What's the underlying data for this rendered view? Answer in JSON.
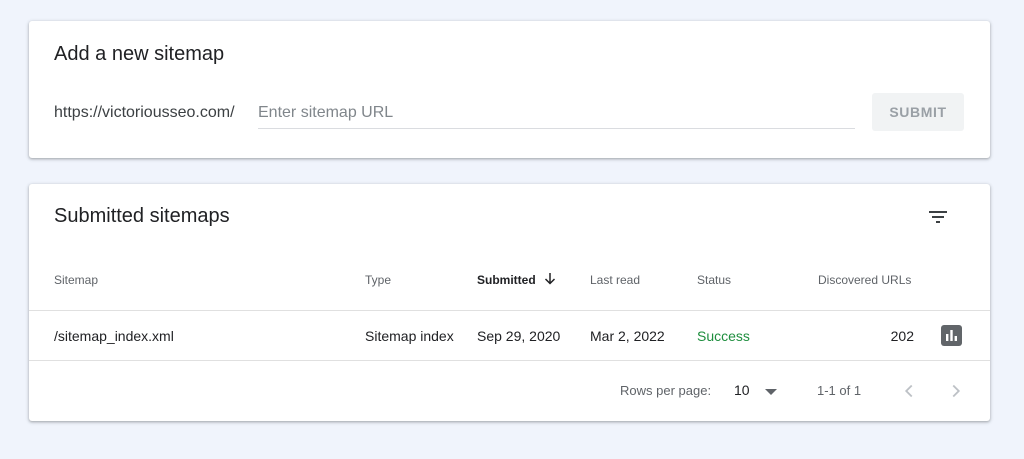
{
  "add_sitemap": {
    "title": "Add a new sitemap",
    "url_prefix": "https://victoriousseo.com/",
    "input_value": "",
    "input_placeholder": "Enter sitemap URL",
    "submit_label": "SUBMIT"
  },
  "submitted": {
    "title": "Submitted sitemaps",
    "columns": {
      "sitemap": "Sitemap",
      "type": "Type",
      "submitted": "Submitted",
      "last_read": "Last read",
      "status": "Status",
      "discovered_urls": "Discovered URLs"
    },
    "rows": [
      {
        "sitemap": "/sitemap_index.xml",
        "type": "Sitemap index",
        "submitted": "Sep 29, 2020",
        "last_read": "Mar 2, 2022",
        "status": "Success",
        "discovered_urls": "202"
      }
    ],
    "pagination": {
      "rows_per_page_label": "Rows per page:",
      "rows_per_page_value": "10",
      "range": "1-1 of 1"
    }
  },
  "icons": {
    "filter": "filter-icon",
    "sort": "arrow-down-icon",
    "chart": "bar-chart-icon",
    "dropdown": "caret-down-icon",
    "prev": "chevron-left-icon",
    "next": "chevron-right-icon"
  },
  "colors": {
    "background": "#f0f4fc",
    "success": "#1e8e3e",
    "submit_bg": "#f1f3f4",
    "submit_text": "#9aa0a6"
  }
}
